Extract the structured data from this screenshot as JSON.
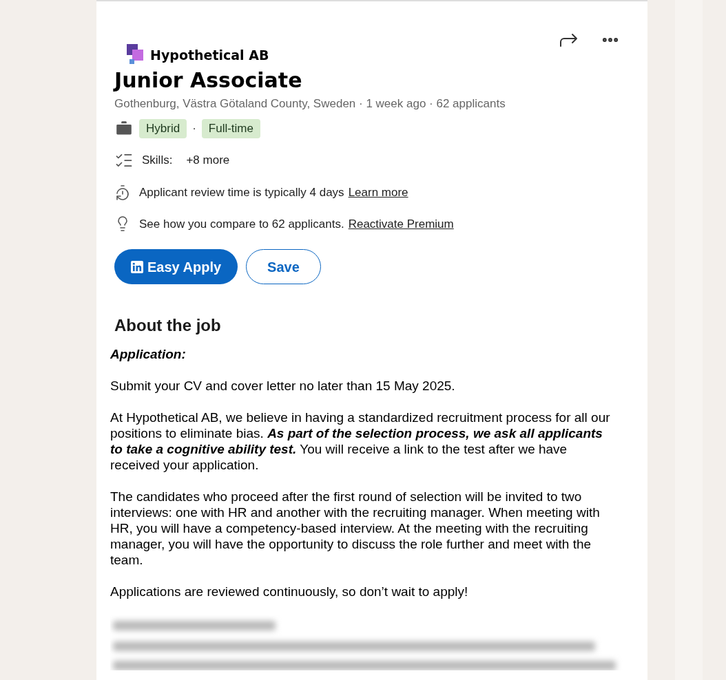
{
  "company": {
    "name": "Hypothetical AB"
  },
  "job": {
    "title": "Junior Associate",
    "meta": "Gothenburg, Västra Götaland County, Sweden · 1 week ago · 62 applicants"
  },
  "tags": [
    "Hybrid",
    "Full-time"
  ],
  "tag_separator": "·",
  "skills": {
    "label": "Skills:",
    "more": "+8 more"
  },
  "insights": [
    {
      "kind": "review",
      "text": "Applicant review time is typically 4 days",
      "link": "Learn more"
    },
    {
      "kind": "compare",
      "text": "See how you compare to 62 applicants.",
      "link": "Reactivate Premium"
    }
  ],
  "buttons": [
    {
      "kind": "primary",
      "label": "Easy Apply"
    },
    {
      "kind": "secondary",
      "label": "Save"
    }
  ],
  "about": {
    "heading": "About the job",
    "paragraphs": [
      {
        "kind": "heading",
        "text": "Application:"
      },
      {
        "kind": "body",
        "text": "Submit your CV and cover letter no later than 15 May 2025."
      },
      {
        "kind": "body",
        "text": "At Hypothetical AB, we believe in having a standardized recruitment process for all our positions to eliminate bias. **As part of the selection process, we ask all applicants to take a cognitive ability test.** You will receive a link to the test after we have received your application."
      },
      {
        "kind": "body",
        "text": "The candidates who proceed after the first round of selection will be invited to two interviews: one with HR and another with the recruiting manager. When meeting with HR, you will have a competency-based interview. At the meeting with the recruiting manager, you will have the opportunity to discuss the role further and meet with the team."
      },
      {
        "kind": "body",
        "text": "Applications are reviewed continuously, so don’t wait to apply!"
      }
    ]
  }
}
